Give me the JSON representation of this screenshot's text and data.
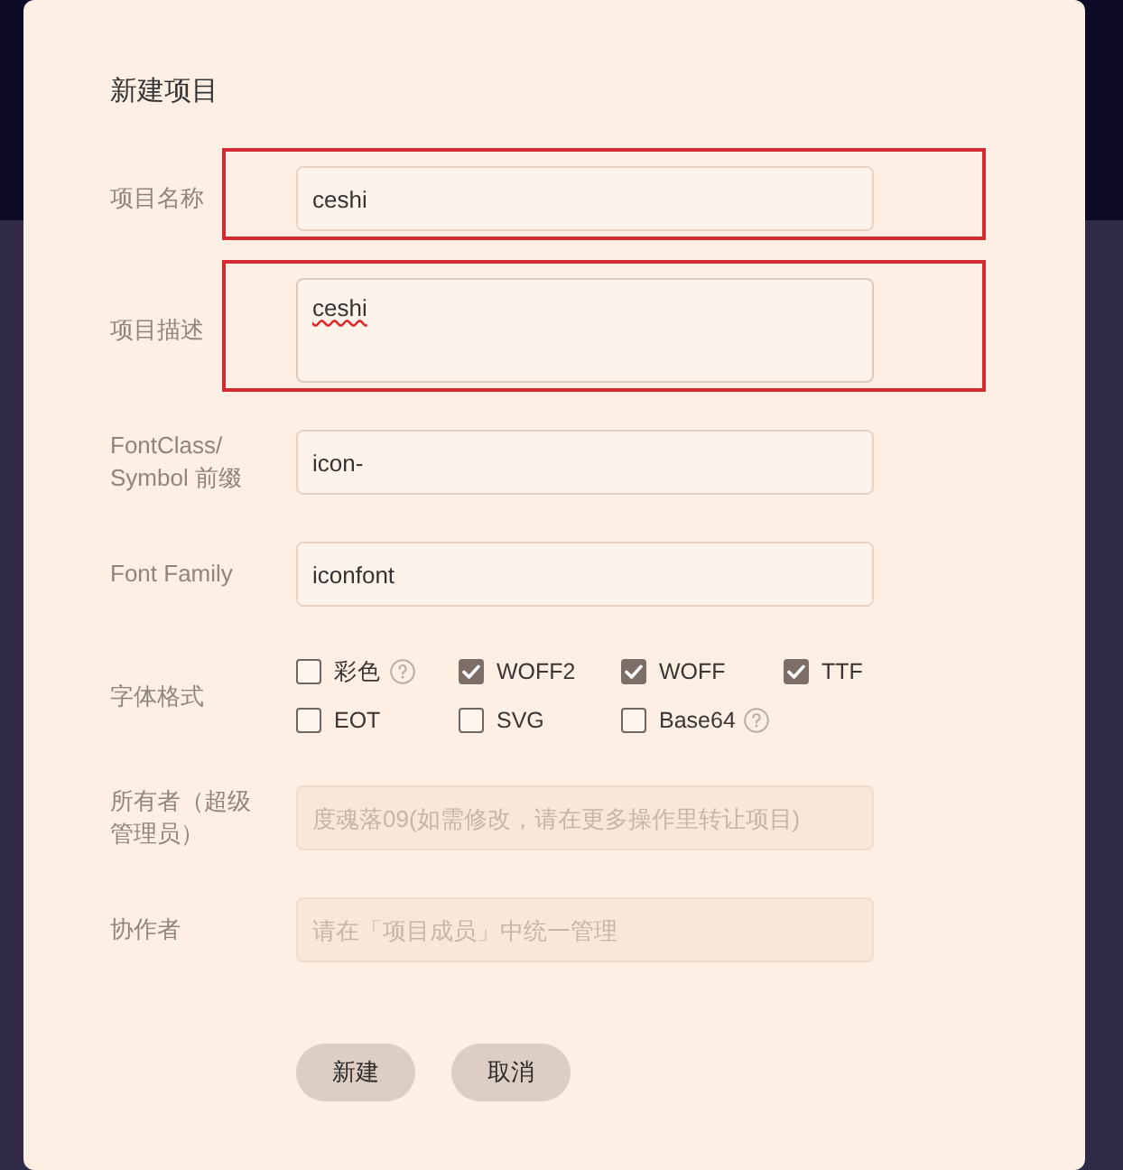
{
  "dialog": {
    "title": "新建项目"
  },
  "rows": [
    {
      "kind": "text",
      "label": "项目名称",
      "value": "ceshi",
      "highlighted": true,
      "misspelled": false,
      "disabled": false
    },
    {
      "kind": "textarea",
      "label": "项目描述",
      "value": "ceshi",
      "highlighted": true,
      "misspelled": true,
      "disabled": false
    },
    {
      "kind": "text",
      "label": "FontClass/ Symbol 前缀",
      "value": "icon-",
      "highlighted": false,
      "misspelled": false,
      "disabled": false
    },
    {
      "kind": "text",
      "label": "Font Family",
      "value": "iconfont",
      "highlighted": false,
      "misspelled": false,
      "disabled": false
    },
    {
      "kind": "checkboxes",
      "label": "字体格式",
      "highlighted": false,
      "options": [
        {
          "label": "彩色",
          "checked": false,
          "help": true
        },
        {
          "label": "WOFF2",
          "checked": true,
          "help": false
        },
        {
          "label": "WOFF",
          "checked": true,
          "help": false
        },
        {
          "label": "TTF",
          "checked": true,
          "help": false
        },
        {
          "label": "EOT",
          "checked": false,
          "help": false
        },
        {
          "label": "SVG",
          "checked": false,
          "help": false
        },
        {
          "label": "Base64",
          "checked": false,
          "help": true
        }
      ]
    },
    {
      "kind": "text",
      "label": "所有者（超级管理员）",
      "placeholder": "度魂落09(如需修改，请在更多操作里转让项目)",
      "highlighted": false,
      "misspelled": false,
      "disabled": true
    },
    {
      "kind": "text",
      "label": "协作者",
      "placeholder": "请在「项目成员」中统一管理",
      "highlighted": false,
      "misspelled": false,
      "disabled": true
    }
  ],
  "buttons": [
    {
      "label": "新建"
    },
    {
      "label": "取消"
    }
  ]
}
